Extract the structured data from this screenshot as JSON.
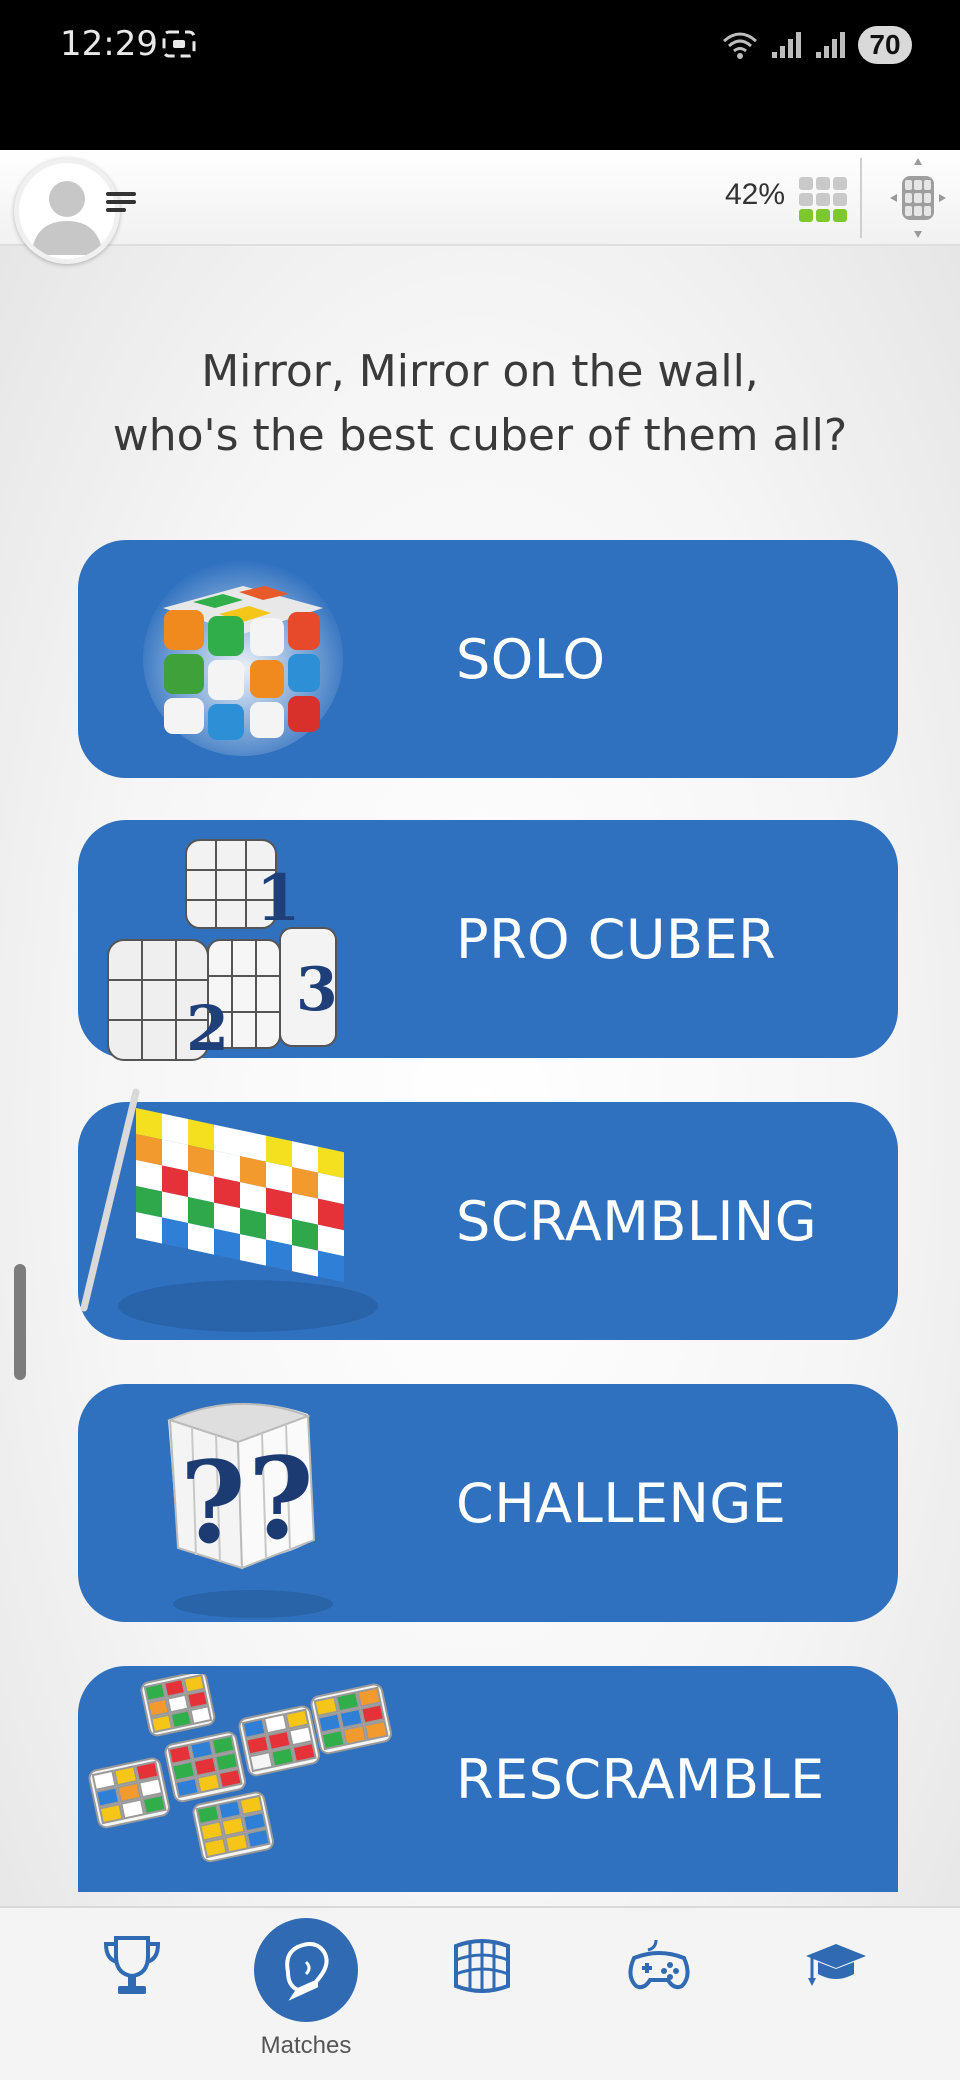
{
  "status_bar": {
    "time": "12:29",
    "battery": "70"
  },
  "header": {
    "progress": "42%",
    "icons": [
      "avatar",
      "menu-icon",
      "cube-grid-icon",
      "cube-navigation-icon"
    ]
  },
  "tagline": {
    "line1": "Mirror, Mirror on the wall,",
    "line2": "who's the best cuber of them all?"
  },
  "modes": [
    {
      "label": "SOLO",
      "icon": "glowing-cube-icon"
    },
    {
      "label": "PRO CUBER",
      "icon": "podium-cubes-icon"
    },
    {
      "label": "SCRAMBLING",
      "icon": "checkered-flag-icon"
    },
    {
      "label": "CHALLENGE",
      "icon": "question-cube-icon"
    },
    {
      "label": "RESCRAMBLE",
      "icon": "unfolded-cube-icon"
    }
  ],
  "bottom_nav": {
    "items": [
      {
        "name": "trophy",
        "label": ""
      },
      {
        "name": "matches",
        "label": "Matches",
        "active": true
      },
      {
        "name": "cube",
        "label": ""
      },
      {
        "name": "gamepad",
        "label": ""
      },
      {
        "name": "graduation-cap",
        "label": ""
      }
    ]
  },
  "colors": {
    "accent": "#3071bf",
    "nav_active": "#2f6ab3",
    "text": "#3a3a3a"
  }
}
